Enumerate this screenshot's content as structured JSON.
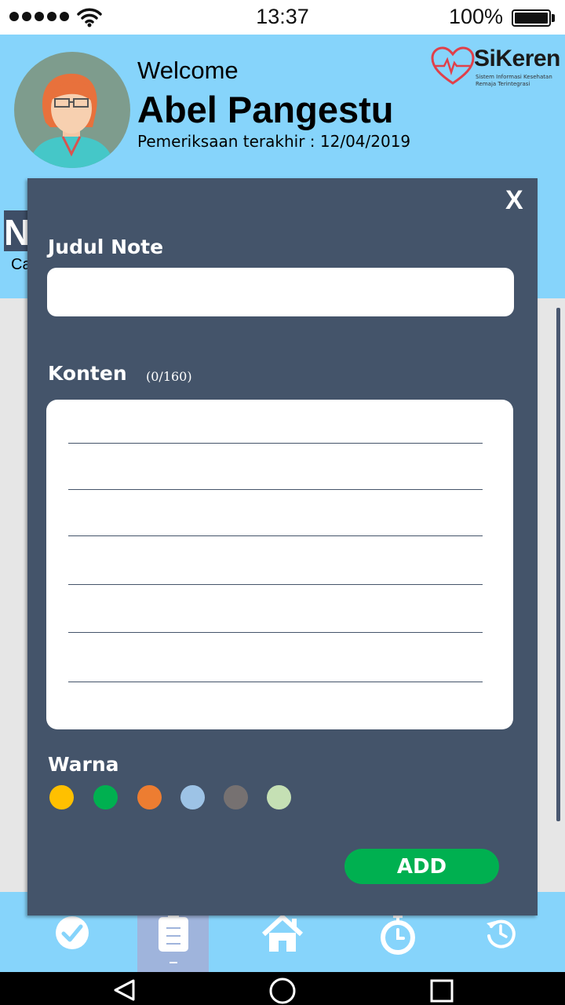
{
  "status_bar": {
    "time": "13:37",
    "battery": "100%"
  },
  "header": {
    "welcome": "Welcome",
    "user_name": "Abel Pangestu",
    "last_check": "Pemeriksaan terakhir : 12/04/2019",
    "logo_name": "SiKeren",
    "logo_subtitle_line1": "Sistem Informasi Kesehatan",
    "logo_subtitle_line2": "Remaja Terintegrasi"
  },
  "background_page": {
    "title_fragment": "N",
    "subtitle_fragment": "Ca"
  },
  "modal": {
    "close_label": "X",
    "title_label": "Judul Note",
    "title_value": "",
    "content_label": "Konten",
    "content_counter": "(0/160)",
    "color_label": "Warna",
    "colors": [
      "#ffc000",
      "#00b050",
      "#ed7d31",
      "#9dc3e6",
      "#767171",
      "#c5e0b4"
    ],
    "add_label": "ADD"
  },
  "bottom_nav": {
    "items": [
      {
        "icon": "checkmark-icon",
        "active": false
      },
      {
        "icon": "clipboard-icon",
        "active": true
      },
      {
        "icon": "home-icon",
        "active": false
      },
      {
        "icon": "stopwatch-icon",
        "active": false
      },
      {
        "icon": "history-icon",
        "active": false
      }
    ]
  },
  "system_nav": {
    "icons": [
      "back-icon",
      "home-circle-icon",
      "recents-icon"
    ]
  }
}
